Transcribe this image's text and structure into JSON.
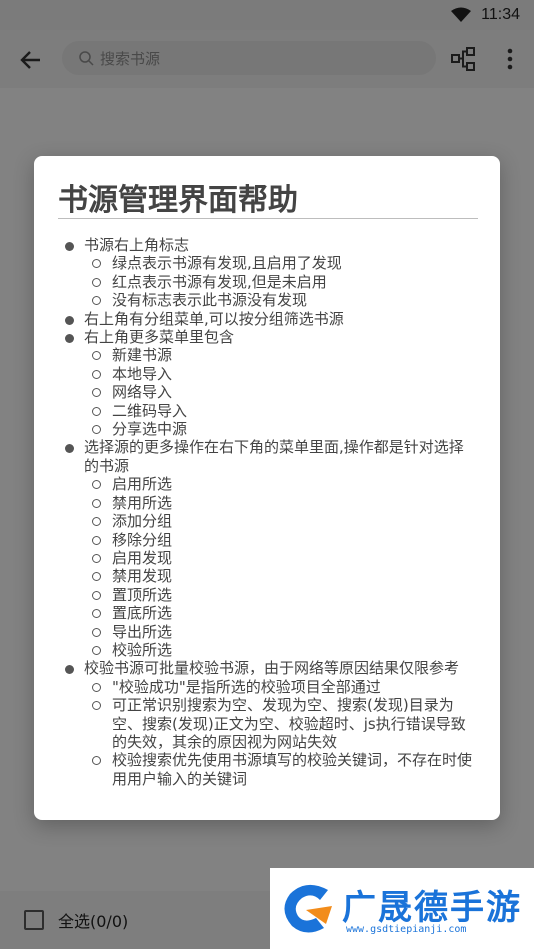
{
  "status_bar": {
    "time": "11:34"
  },
  "app_bar": {
    "search_placeholder": "搜索书源"
  },
  "bottom_bar": {
    "select_all_label": "全选(0/0)"
  },
  "dialog": {
    "title": "书源管理界面帮助",
    "items": [
      {
        "text": "书源右上角标志",
        "children": [
          "绿点表示书源有发现,且启用了发现",
          "红点表示书源有发现,但是未启用",
          "没有标志表示此书源没有发现"
        ]
      },
      {
        "text": "右上角有分组菜单,可以按分组筛选书源",
        "children": []
      },
      {
        "text": "右上角更多菜单里包含",
        "children": [
          "新建书源",
          "本地导入",
          "网络导入",
          "二维码导入",
          "分享选中源"
        ]
      },
      {
        "text": "选择源的更多操作在右下角的菜单里面,操作都是针对选择的书源",
        "children": [
          "启用所选",
          "禁用所选",
          "添加分组",
          "移除分组",
          "启用发现",
          "禁用发现",
          "置顶所选",
          "置底所选",
          "导出所选",
          "校验所选"
        ]
      },
      {
        "text": "校验书源可批量校验书源，由于网络等原因结果仅限参考",
        "children": [
          "\"校验成功\"是指所选的校验项目全部通过",
          "可正常识别搜索为空、发现为空、搜索(发现)目录为空、搜索(发现)正文为空、校验超时、js执行错误导致的失效，其余的原因视为网站失效",
          "校验搜索优先使用书源填写的校验关键词，不存在时使用用户输入的关键词"
        ]
      }
    ]
  },
  "watermark": {
    "brand": "广晟德手游",
    "url": "www.gsdtiepianji.com"
  }
}
